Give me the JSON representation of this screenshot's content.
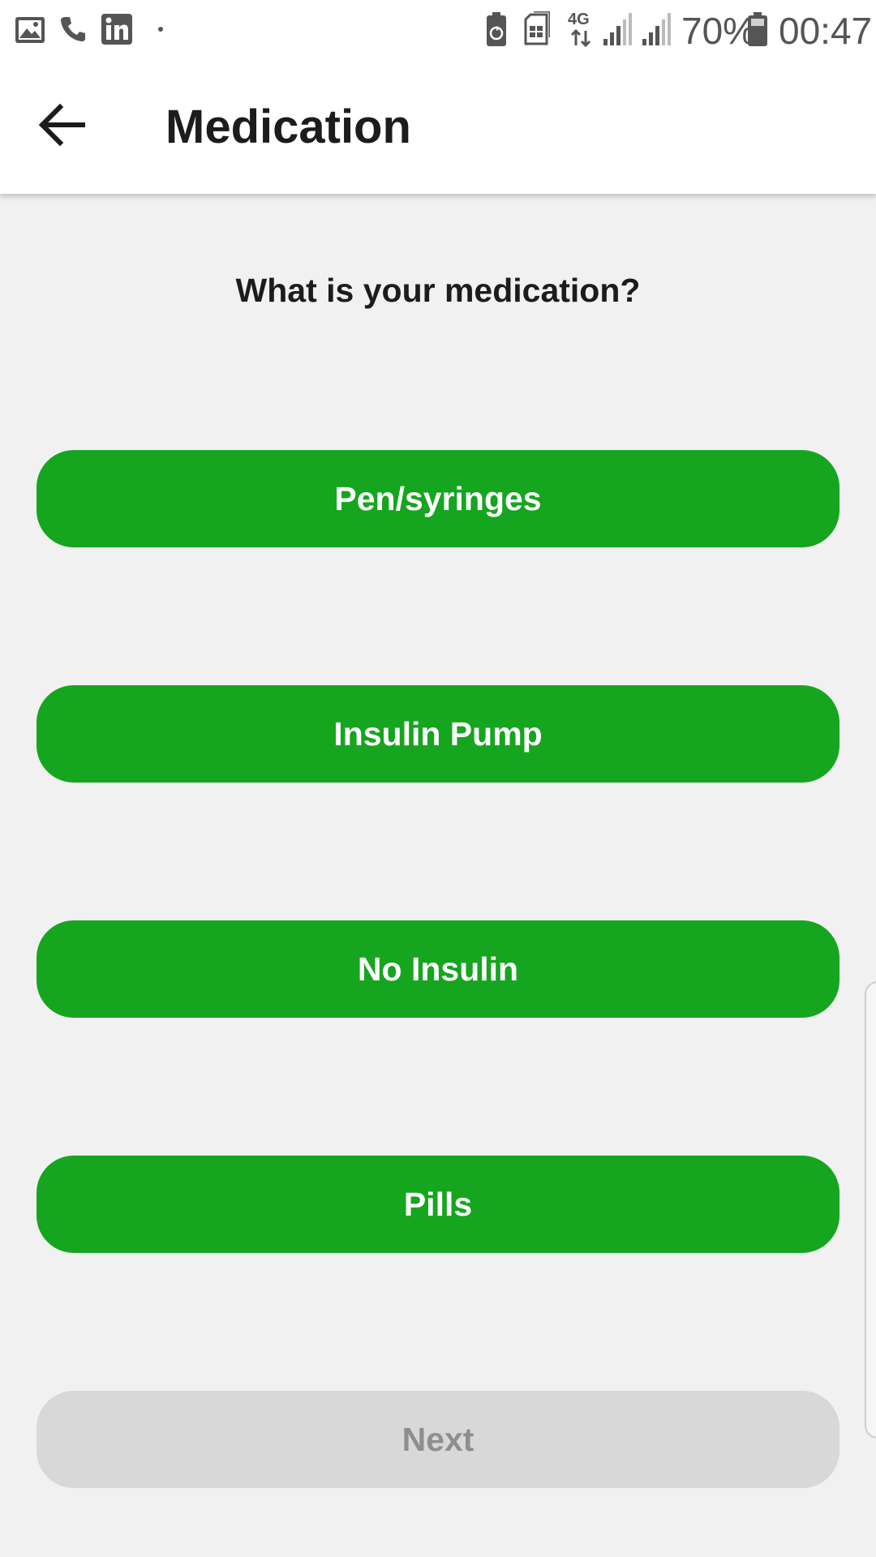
{
  "status_bar": {
    "icons_left": [
      "gallery-icon",
      "phone-icon",
      "linkedin-icon",
      "notification-dot-icon"
    ],
    "icons_right": [
      "battery-saver-icon",
      "sim-card-icon",
      "4g-data-icon",
      "signal-icon",
      "signal-icon"
    ],
    "network_label": "4G",
    "battery": "70%",
    "time": "00:47"
  },
  "app_bar": {
    "back_icon": "arrow-left-icon",
    "title": "Medication"
  },
  "content": {
    "question": "What is your medication?",
    "options": [
      {
        "label": "Pen/syringes"
      },
      {
        "label": "Insulin Pump"
      },
      {
        "label": "No Insulin"
      },
      {
        "label": "Pills"
      }
    ],
    "next_label": "Next"
  },
  "colors": {
    "primary_green": "#16a51f",
    "disabled_button": "#d8d8d8",
    "disabled_text": "#8e8e8e",
    "background": "#f1f1f1"
  }
}
